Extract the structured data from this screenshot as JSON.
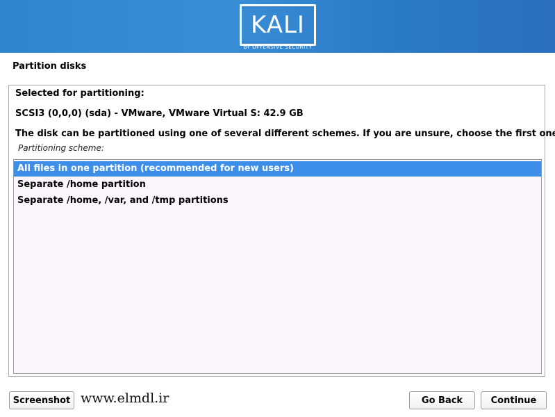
{
  "banner": {
    "logo_text": "KALI",
    "logo_subtitle": "BY OFFENSIVE SECURITY"
  },
  "page_title": "Partition disks",
  "content": {
    "selected_heading": "Selected for partitioning:",
    "disk_line": "SCSI3 (0,0,0) (sda) - VMware, VMware Virtual S: 42.9 GB",
    "description": "The disk can be partitioned using one of several different schemes. If you are unsure, choose the first one.",
    "scheme_label": "Partitioning scheme:",
    "options": [
      {
        "label": "All files in one partition (recommended for new users)",
        "selected": true
      },
      {
        "label": "Separate /home partition",
        "selected": false
      },
      {
        "label": "Separate /home, /var, and /tmp partitions",
        "selected": false
      }
    ]
  },
  "footer": {
    "screenshot_label": "Screenshot",
    "watermark": "www.elmdl.ir",
    "go_back_label": "Go Back",
    "continue_label": "Continue"
  }
}
